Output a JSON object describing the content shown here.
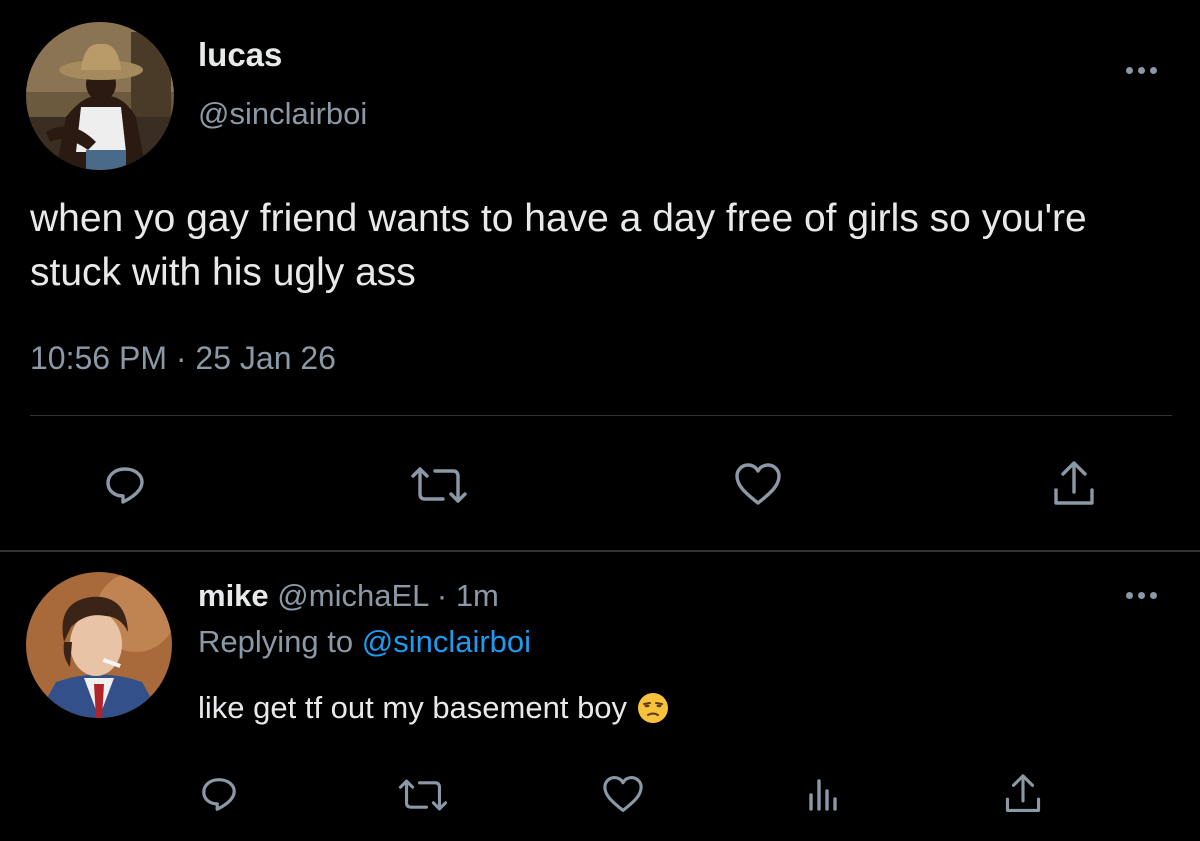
{
  "main_tweet": {
    "author_name": "lucas",
    "author_handle": "@sinclairboi",
    "text": "when yo gay friend wants to have a day free of girls so you're stuck with his ugly ass",
    "timestamp": "10:56 PM · 25 Jan 26",
    "actions": [
      "reply-icon",
      "retweet-icon",
      "like-icon",
      "share-icon"
    ]
  },
  "reply": {
    "author_name": "mike",
    "author_handle": "@michaEL",
    "separator": "·",
    "time": "1m",
    "replying_prefix": "Replying to",
    "replying_to": "@sinclairboi",
    "text": "like get tf out my basement boy",
    "emoji": "unamused-face",
    "actions": [
      "reply-icon",
      "retweet-icon",
      "like-icon",
      "analytics-icon",
      "share-icon"
    ]
  },
  "colors": {
    "background": "#000000",
    "text": "#e7e9ea",
    "muted": "#8b98a5",
    "link": "#1d9bf0",
    "divider": "#2f3336"
  }
}
